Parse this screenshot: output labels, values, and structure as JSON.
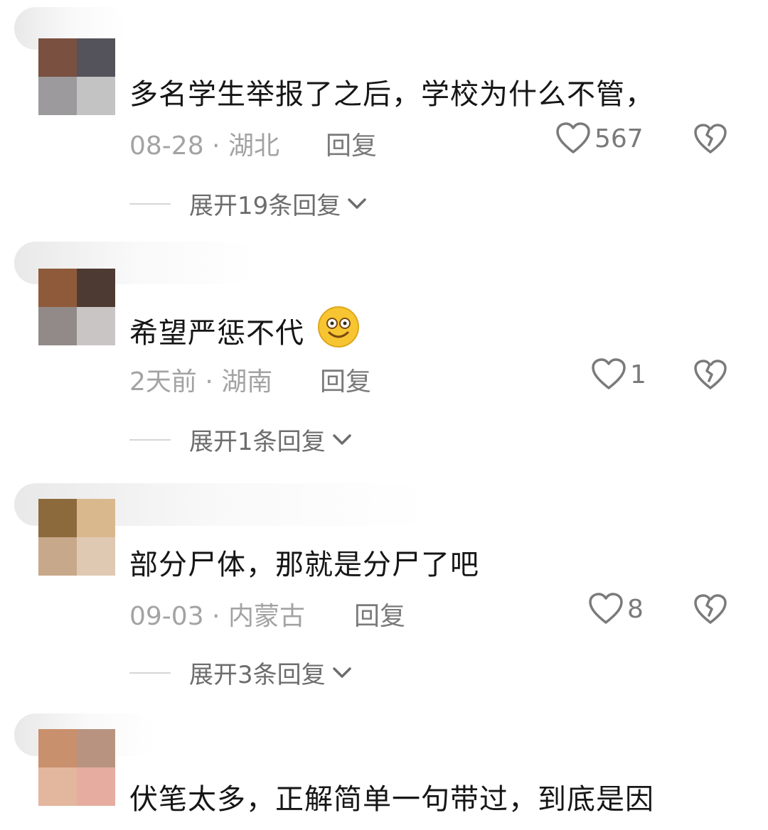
{
  "comments": [
    {
      "text": "多名学生举报了之后，学校为什么不管，",
      "date": "08-28",
      "separator": " · ",
      "location": "湖北",
      "reply_label": "回复",
      "likes": "567",
      "expand_label": "展开19条回复",
      "avatar_colors": [
        "#7a5040",
        "#54525a",
        "#9c9a9c",
        "#c3c3c3"
      ]
    },
    {
      "text": "希望严惩不代",
      "emoji": "smiling-face-emoji",
      "date": "2天前",
      "separator": " · ",
      "location": "湖南",
      "reply_label": "回复",
      "likes": "1",
      "expand_label": "展开1条回复",
      "avatar_colors": [
        "#8f5a3a",
        "#4d3a32",
        "#918a88",
        "#c9c5c4"
      ]
    },
    {
      "text": "部分尸体，那就是分尸了吧",
      "date": "09-03",
      "separator": " · ",
      "location": "内蒙古",
      "reply_label": "回复",
      "likes": "8",
      "expand_label": "展开3条回复",
      "avatar_colors": [
        "#8c6a3c",
        "#d9b88e",
        "#c8a88a",
        "#dfc9b3"
      ]
    },
    {
      "text": "伏笔太多，正解简单一句带过，到底是因",
      "avatar_colors": [
        "#c8906c",
        "#b89480",
        "#e3b69e",
        "#e6aca0"
      ]
    }
  ],
  "icons": {
    "like": "heart-outline-icon",
    "dislike": "broken-heart-icon",
    "expand": "chevron-down-icon"
  },
  "colors": {
    "text": "#161616",
    "meta": "#a3a3a3",
    "action": "#7a7a7a"
  }
}
